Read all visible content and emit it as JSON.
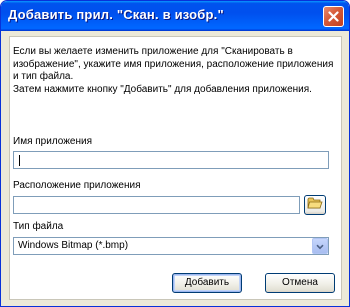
{
  "window": {
    "title": "Добавить прил. \"Скан. в изобр.\""
  },
  "description": {
    "line1": "Если вы желаете изменить приложение для \"Сканировать в изображение\", укажите имя приложения, расположение приложения и тип файла.",
    "line2": "Затем нажмите кнопку \"Добавить\" для добавления приложения."
  },
  "fields": {
    "app_name_label": "Имя приложения",
    "app_name_value": "",
    "app_location_label": "Расположение приложения",
    "app_location_value": "",
    "file_type_label": "Тип файла",
    "file_type_value": "Windows Bitmap (*.bmp)"
  },
  "buttons": {
    "add": "Добавить",
    "cancel": "Отмена"
  },
  "icons": {
    "close": "close-icon",
    "browse": "folder-icon",
    "dropdown": "chevron-down-icon"
  },
  "colors": {
    "titlebar": "#0053ee",
    "close_button": "#d65a38",
    "dialog_bg": "#ece9d8"
  }
}
